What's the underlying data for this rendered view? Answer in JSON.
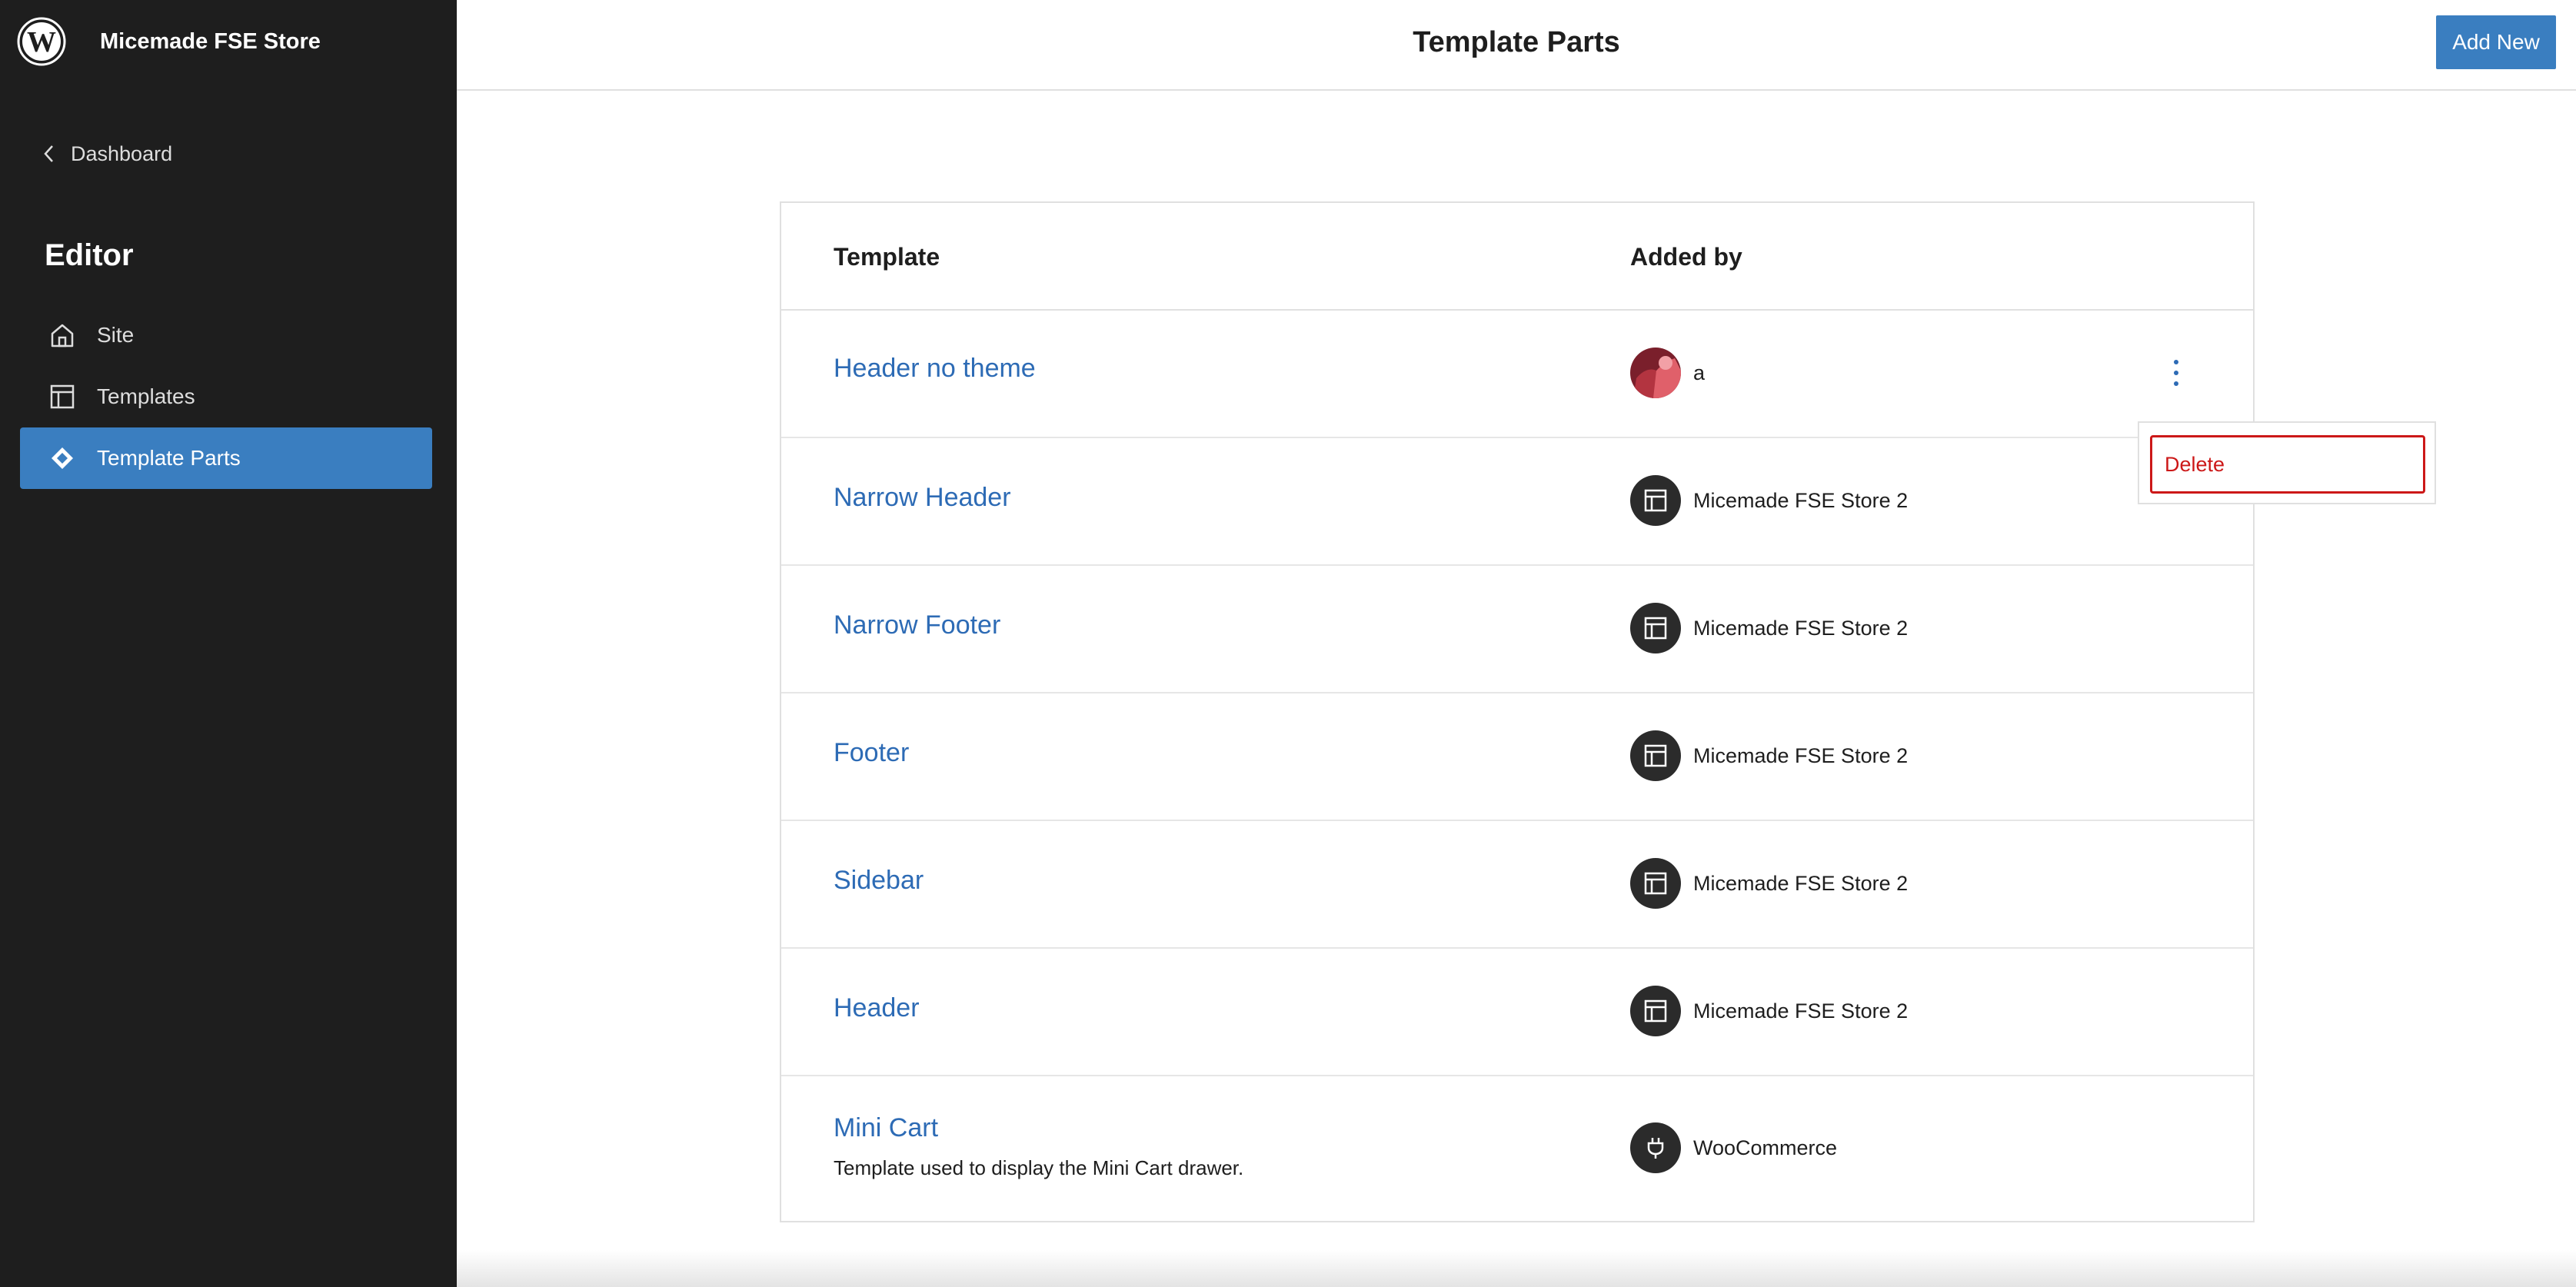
{
  "sidebar": {
    "site_name": "Micemade FSE Store",
    "back_label": "Dashboard",
    "section_title": "Editor",
    "items": [
      {
        "label": "Site",
        "icon": "home-icon",
        "active": false
      },
      {
        "label": "Templates",
        "icon": "layout-icon",
        "active": false
      },
      {
        "label": "Template Parts",
        "icon": "symbol-filled-icon",
        "active": true
      }
    ]
  },
  "header": {
    "title": "Template Parts",
    "add_new_label": "Add New"
  },
  "table": {
    "columns": [
      "Template",
      "Added by"
    ],
    "rows": [
      {
        "title": "Header no theme",
        "description": "",
        "author": "a",
        "author_type": "user-avatar"
      },
      {
        "title": "Narrow Header",
        "description": "",
        "author": "Micemade FSE Store 2",
        "author_type": "layout-icon"
      },
      {
        "title": "Narrow Footer",
        "description": "",
        "author": "Micemade FSE Store 2",
        "author_type": "layout-icon"
      },
      {
        "title": "Footer",
        "description": "",
        "author": "Micemade FSE Store 2",
        "author_type": "layout-icon"
      },
      {
        "title": "Sidebar",
        "description": "",
        "author": "Micemade FSE Store 2",
        "author_type": "layout-icon"
      },
      {
        "title": "Header",
        "description": "",
        "author": "Micemade FSE Store 2",
        "author_type": "layout-icon"
      },
      {
        "title": "Mini Cart",
        "description": "Template used to display the Mini Cart drawer.",
        "author": "WooCommerce",
        "author_type": "plugin-icon"
      }
    ]
  },
  "row_menu": {
    "delete_label": "Delete"
  },
  "colors": {
    "sidebar_bg": "#1e1e1e",
    "accent": "#3a7ec0",
    "link": "#2d6bb5",
    "danger": "#cc1818"
  }
}
